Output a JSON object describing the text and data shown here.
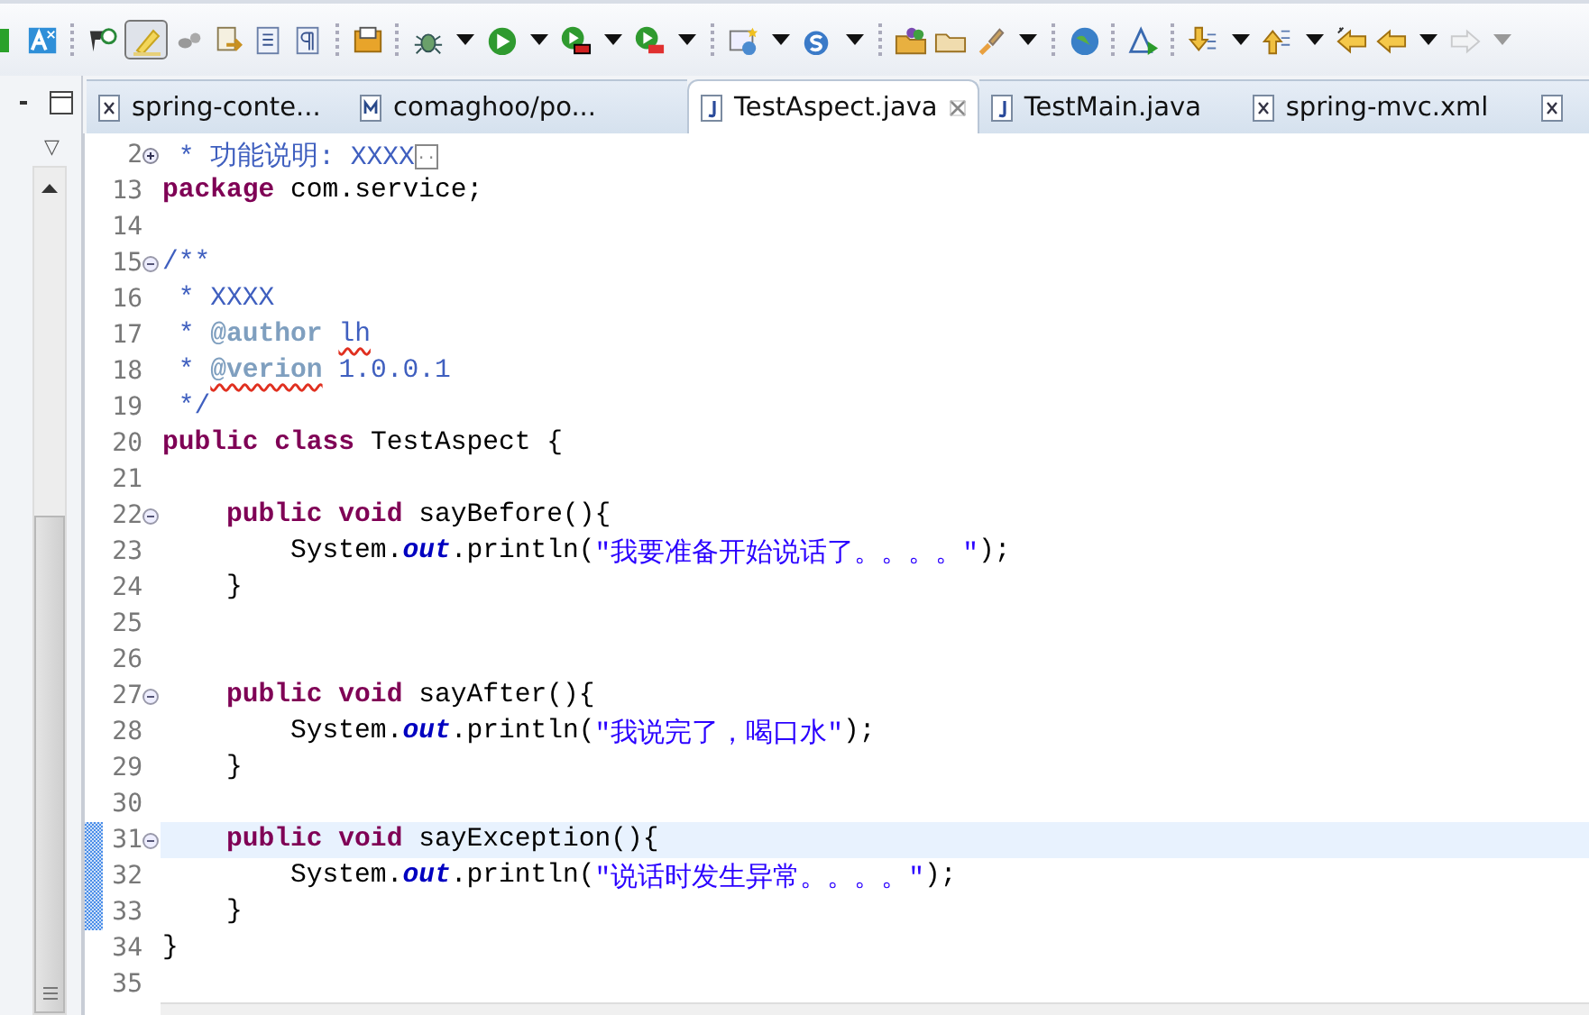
{
  "toolbar": [
    {
      "kind": "green",
      "dropdown": false,
      "selected": false,
      "disabled": false
    },
    {
      "kind": "font",
      "dropdown": false,
      "selected": false,
      "disabled": false
    },
    {
      "kind": "separator"
    },
    {
      "kind": "tag",
      "dropdown": false,
      "selected": false,
      "disabled": false
    },
    {
      "kind": "highlighter",
      "dropdown": false,
      "selected": true,
      "disabled": false
    },
    {
      "kind": "footprints",
      "dropdown": false,
      "selected": false,
      "disabled": false
    },
    {
      "kind": "doc-arrow",
      "dropdown": false,
      "selected": false,
      "disabled": false
    },
    {
      "kind": "lines",
      "dropdown": false,
      "selected": false,
      "disabled": false
    },
    {
      "kind": "pilcrow",
      "dropdown": false,
      "selected": false,
      "disabled": false
    },
    {
      "kind": "separator"
    },
    {
      "kind": "box",
      "dropdown": false,
      "selected": false,
      "disabled": false
    },
    {
      "kind": "separator"
    },
    {
      "kind": "bug",
      "dropdown": true,
      "selected": false,
      "disabled": false
    },
    {
      "kind": "run",
      "dropdown": true,
      "selected": false,
      "disabled": false
    },
    {
      "kind": "run-red",
      "dropdown": true,
      "selected": false,
      "disabled": false
    },
    {
      "kind": "run-toolbox",
      "dropdown": true,
      "selected": false,
      "disabled": false
    },
    {
      "kind": "separator"
    },
    {
      "kind": "window-star",
      "dropdown": true,
      "selected": false,
      "disabled": false
    },
    {
      "kind": "s-circle",
      "dropdown": true,
      "selected": false,
      "disabled": false
    },
    {
      "kind": "separator"
    },
    {
      "kind": "folder-balls",
      "dropdown": false,
      "selected": false,
      "disabled": false
    },
    {
      "kind": "folder",
      "dropdown": false,
      "selected": false,
      "disabled": false
    },
    {
      "kind": "brush",
      "dropdown": true,
      "selected": false,
      "disabled": false
    },
    {
      "kind": "separator"
    },
    {
      "kind": "globe",
      "dropdown": false,
      "selected": false,
      "disabled": false
    },
    {
      "kind": "separator"
    },
    {
      "kind": "triangle-play",
      "dropdown": false,
      "selected": false,
      "disabled": false
    },
    {
      "kind": "separator"
    },
    {
      "kind": "arrow-down-doc",
      "dropdown": true,
      "selected": false,
      "disabled": false
    },
    {
      "kind": "arrow-up-doc",
      "dropdown": true,
      "selected": false,
      "disabled": false
    },
    {
      "kind": "arrow-left-star",
      "dropdown": false,
      "selected": false,
      "disabled": false
    },
    {
      "kind": "arrow-left",
      "dropdown": true,
      "selected": false,
      "disabled": false
    },
    {
      "kind": "arrow-right",
      "dropdown": true,
      "selected": false,
      "disabled": true
    }
  ],
  "side_panel": {
    "view_menu": "▽"
  },
  "tabs": [
    {
      "kind": "xml",
      "label": "spring-conte...",
      "selected": false
    },
    {
      "kind": "maven",
      "label": "comaghoo/po...",
      "selected": false
    },
    {
      "kind": "java",
      "label": "TestAspect.java",
      "selected": true
    },
    {
      "kind": "java",
      "label": "TestMain.java",
      "selected": false
    },
    {
      "kind": "xml",
      "label": "spring-mvc.xml",
      "selected": false
    },
    {
      "kind": "xml",
      "selected": false
    }
  ],
  "editor": {
    "lines": [
      {
        "number": "2",
        "collapsible": true,
        "collapsed": true,
        "current": false,
        "changed": false,
        "tokens": [
          {
            "kind": "javadoc",
            "text": " * 功能说明: XXXX"
          },
          {
            "kind": "folded",
            "text": ".."
          }
        ]
      },
      {
        "number": "13",
        "collapsible": false,
        "current": false,
        "changed": false,
        "tokens": [
          {
            "kind": "keyword",
            "text": "package"
          },
          {
            "kind": "plain",
            "text": " com.service;"
          }
        ]
      },
      {
        "number": "14",
        "collapsible": false,
        "current": false,
        "changed": false
      },
      {
        "number": "15",
        "collapsible": true,
        "collapsed": false,
        "current": false,
        "changed": false,
        "tokens": [
          {
            "kind": "javadoc",
            "text": "/**"
          }
        ]
      },
      {
        "number": "16",
        "collapsible": false,
        "current": false,
        "changed": false,
        "tokens": [
          {
            "kind": "javadoc",
            "text": " * XXXX"
          }
        ]
      },
      {
        "number": "17",
        "collapsible": false,
        "current": false,
        "changed": false,
        "tokens": [
          {
            "kind": "javadoc",
            "text": " * "
          },
          {
            "kind": "javadoc_tag",
            "text": "@author "
          },
          {
            "kind": "javadoc",
            "text": "lh",
            "misspelled": true
          }
        ]
      },
      {
        "number": "18",
        "collapsible": false,
        "current": false,
        "changed": false,
        "tokens": [
          {
            "kind": "javadoc",
            "text": " * "
          },
          {
            "kind": "javadoc_tag",
            "text": "@verion",
            "misspelled": true
          },
          {
            "kind": "javadoc",
            "text": " 1.0.0.1"
          }
        ]
      },
      {
        "number": "19",
        "collapsible": false,
        "current": false,
        "changed": false,
        "tokens": [
          {
            "kind": "javadoc",
            "text": " */"
          }
        ]
      },
      {
        "number": "20",
        "collapsible": false,
        "current": false,
        "changed": false,
        "tokens": [
          {
            "kind": "keyword",
            "text": "public"
          },
          {
            "kind": "keyword",
            "text": " class"
          },
          {
            "kind": "plain",
            "text": " TestAspect {"
          }
        ]
      },
      {
        "number": "21",
        "collapsible": false,
        "current": false,
        "changed": false
      },
      {
        "number": "22",
        "collapsible": true,
        "collapsed": false,
        "current": false,
        "changed": false,
        "tokens": [
          {
            "kind": "keyword",
            "text": "    public"
          },
          {
            "kind": "keyword",
            "text": " void"
          },
          {
            "kind": "plain",
            "text": " sayBefore(){"
          }
        ]
      },
      {
        "number": "23",
        "collapsible": false,
        "current": false,
        "changed": false,
        "tokens": [
          {
            "kind": "plain",
            "text": "        System."
          },
          {
            "kind": "static_field",
            "text": "out"
          },
          {
            "kind": "plain",
            "text": ".println("
          },
          {
            "kind": "string",
            "text": "\"我要准备开始说话了。。。。\""
          },
          {
            "kind": "plain",
            "text": ");"
          }
        ]
      },
      {
        "number": "24",
        "collapsible": false,
        "current": false,
        "changed": false,
        "tokens": [
          {
            "kind": "plain",
            "text": "    }"
          }
        ]
      },
      {
        "number": "25",
        "collapsible": false,
        "current": false,
        "changed": false
      },
      {
        "number": "26",
        "collapsible": false,
        "current": false,
        "changed": false
      },
      {
        "number": "27",
        "collapsible": true,
        "collapsed": false,
        "current": false,
        "changed": false,
        "tokens": [
          {
            "kind": "keyword",
            "text": "    public"
          },
          {
            "kind": "keyword",
            "text": " void"
          },
          {
            "kind": "plain",
            "text": " sayAfter(){"
          }
        ]
      },
      {
        "number": "28",
        "collapsible": false,
        "current": false,
        "changed": false,
        "tokens": [
          {
            "kind": "plain",
            "text": "        System."
          },
          {
            "kind": "static_field",
            "text": "out"
          },
          {
            "kind": "plain",
            "text": ".println("
          },
          {
            "kind": "string",
            "text": "\"我说完了，喝口水\""
          },
          {
            "kind": "plain",
            "text": ");"
          }
        ]
      },
      {
        "number": "29",
        "collapsible": false,
        "current": false,
        "changed": false,
        "tokens": [
          {
            "kind": "plain",
            "text": "    }"
          }
        ]
      },
      {
        "number": "30",
        "collapsible": false,
        "current": false,
        "changed": false
      },
      {
        "number": "31",
        "collapsible": true,
        "collapsed": false,
        "current": true,
        "changed": true,
        "tokens": [
          {
            "kind": "keyword",
            "text": "    public"
          },
          {
            "kind": "keyword",
            "text": " void"
          },
          {
            "kind": "plain",
            "text": " sayException(){"
          }
        ]
      },
      {
        "number": "32",
        "collapsible": false,
        "current": false,
        "changed": true,
        "tokens": [
          {
            "kind": "plain",
            "text": "        System."
          },
          {
            "kind": "static_field",
            "text": "out"
          },
          {
            "kind": "plain",
            "text": ".println("
          },
          {
            "kind": "string",
            "text": "\"说话时发生异常。。。。\""
          },
          {
            "kind": "plain",
            "text": ");"
          }
        ]
      },
      {
        "number": "33",
        "collapsible": false,
        "current": false,
        "changed": true,
        "tokens": [
          {
            "kind": "plain",
            "text": "    }"
          }
        ]
      },
      {
        "number": "34",
        "collapsible": false,
        "current": false,
        "changed": false,
        "tokens": [
          {
            "kind": "plain",
            "text": "}"
          }
        ]
      },
      {
        "number": "35",
        "collapsible": false,
        "current": false,
        "changed": false
      }
    ]
  }
}
